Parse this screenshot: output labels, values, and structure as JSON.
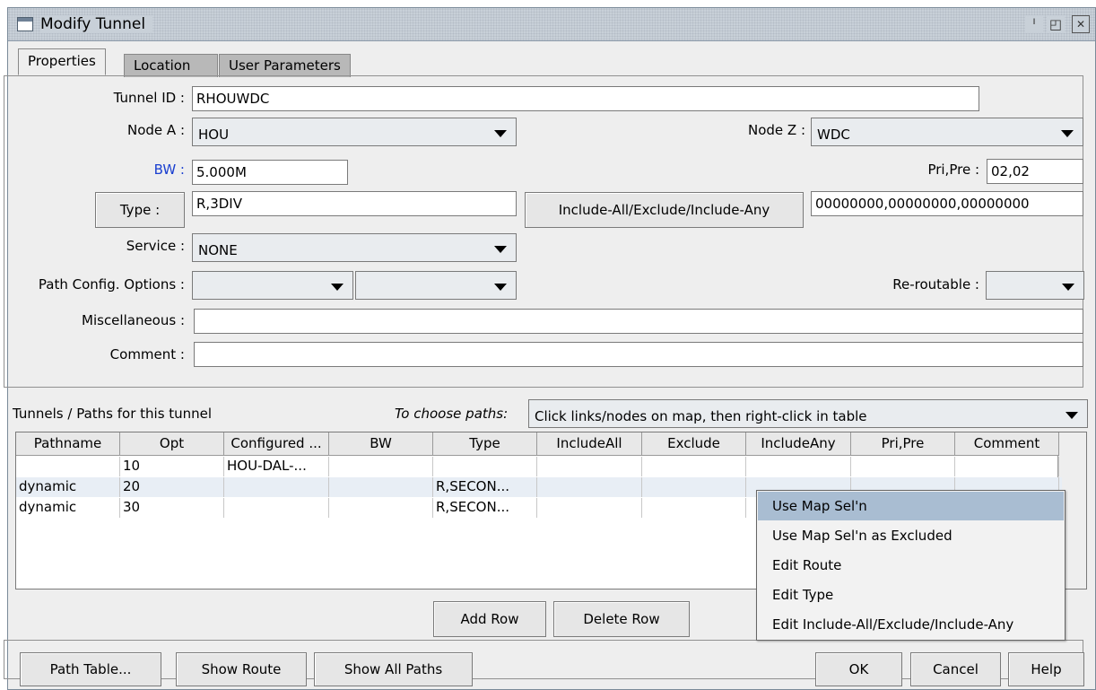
{
  "window": {
    "title": "Modify Tunnel",
    "controls": {
      "minimize_icon": "ᑊ",
      "restore_icon": "◰",
      "close_icon": "✕"
    }
  },
  "tabs": [
    {
      "label": "Properties",
      "active": true
    },
    {
      "label": "Location",
      "active": false
    },
    {
      "label": "User Parameters",
      "active": false
    }
  ],
  "form": {
    "tunnel_id_label": "Tunnel ID :",
    "tunnel_id_value": "RHOUWDC",
    "node_a_label": "Node A :",
    "node_a_value": "HOU",
    "node_z_label": "Node Z :",
    "node_z_value": "WDC",
    "bw_label": "BW :",
    "bw_value": "5.000M",
    "pri_pre_label": "Pri,Pre :",
    "pri_pre_value": "02,02",
    "type_button": "Type :",
    "type_value": "R,3DIV",
    "include_button": "Include-All/Exclude/Include-Any",
    "include_value": "00000000,00000000,00000000",
    "service_label": "Service :",
    "service_value": "NONE",
    "path_config_label": "Path Config. Options :",
    "path_config_value_1": "",
    "path_config_value_2": "",
    "reroutable_label": "Re-routable :",
    "reroutable_value": "",
    "misc_label": "Miscellaneous :",
    "misc_value": "",
    "comment_label": "Comment :",
    "comment_value": ""
  },
  "paths": {
    "section_label": "Tunnels / Paths for this tunnel",
    "choose_label": "To choose paths:",
    "choose_value": "Click links/nodes on map, then right-click in table",
    "columns": [
      "Pathname",
      "Opt",
      "Configured ...",
      "BW",
      "Type",
      "IncludeAll",
      "Exclude",
      "IncludeAny",
      "Pri,Pre",
      "Comment"
    ],
    "rows": [
      [
        "",
        "10",
        "HOU-DAL-...",
        "",
        "",
        "",
        "",
        "",
        "",
        ""
      ],
      [
        "dynamic",
        "20",
        "",
        "",
        "R,SECON...",
        "",
        "",
        "",
        "",
        ""
      ],
      [
        "dynamic",
        "30",
        "",
        "",
        "R,SECON...",
        "",
        "",
        "",
        "",
        ""
      ]
    ],
    "add_row_button": "Add Row",
    "delete_row_button": "Delete Row"
  },
  "context_menu": {
    "items": [
      "Use Map Sel'n",
      "Use Map Sel'n as Excluded",
      "Edit Route",
      "Edit Type",
      "Edit Include-All/Exclude/Include-Any"
    ],
    "highlighted_index": 0
  },
  "bottom": {
    "path_table_button": "Path Table...",
    "show_route_button": "Show Route",
    "show_all_paths_button": "Show All Paths",
    "ok_button": "OK",
    "cancel_button": "Cancel",
    "help_button": "Help"
  },
  "colors": {
    "window_bg": "#eeeeee",
    "title_bg": "#c8d0d8",
    "highlight": "#a9bdd2",
    "bw_label": "#1a3fd0"
  }
}
